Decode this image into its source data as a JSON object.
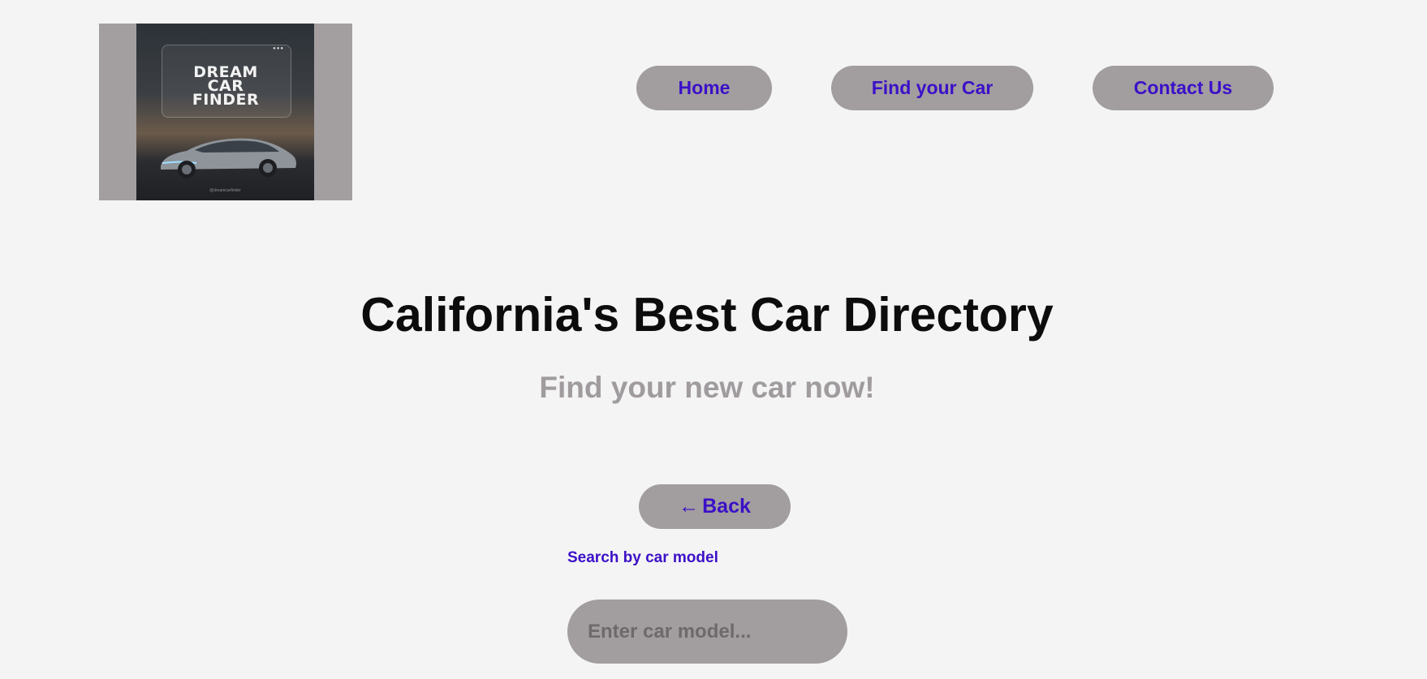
{
  "header": {
    "logo": {
      "text_lines": [
        "DREAM",
        "CAR",
        "FINDER"
      ],
      "tagline": "@dreamcarfinder",
      "image": "sports-car-photo"
    },
    "nav": [
      {
        "label": "Home"
      },
      {
        "label": "Find your Car"
      },
      {
        "label": "Contact Us"
      }
    ]
  },
  "hero": {
    "title": "California's Best Car Directory",
    "subtitle": "Find your new car now!"
  },
  "back_button": {
    "arrow": "←",
    "label": "Back"
  },
  "search": {
    "label": "Search by car model",
    "placeholder": "Enter car model...",
    "value": ""
  },
  "colors": {
    "background": "#f4f4f4",
    "button_bg": "#a29d9f",
    "accent_text": "#3b10c8",
    "title_text": "#0c0c0c",
    "subtitle_text": "#a09b9e"
  }
}
